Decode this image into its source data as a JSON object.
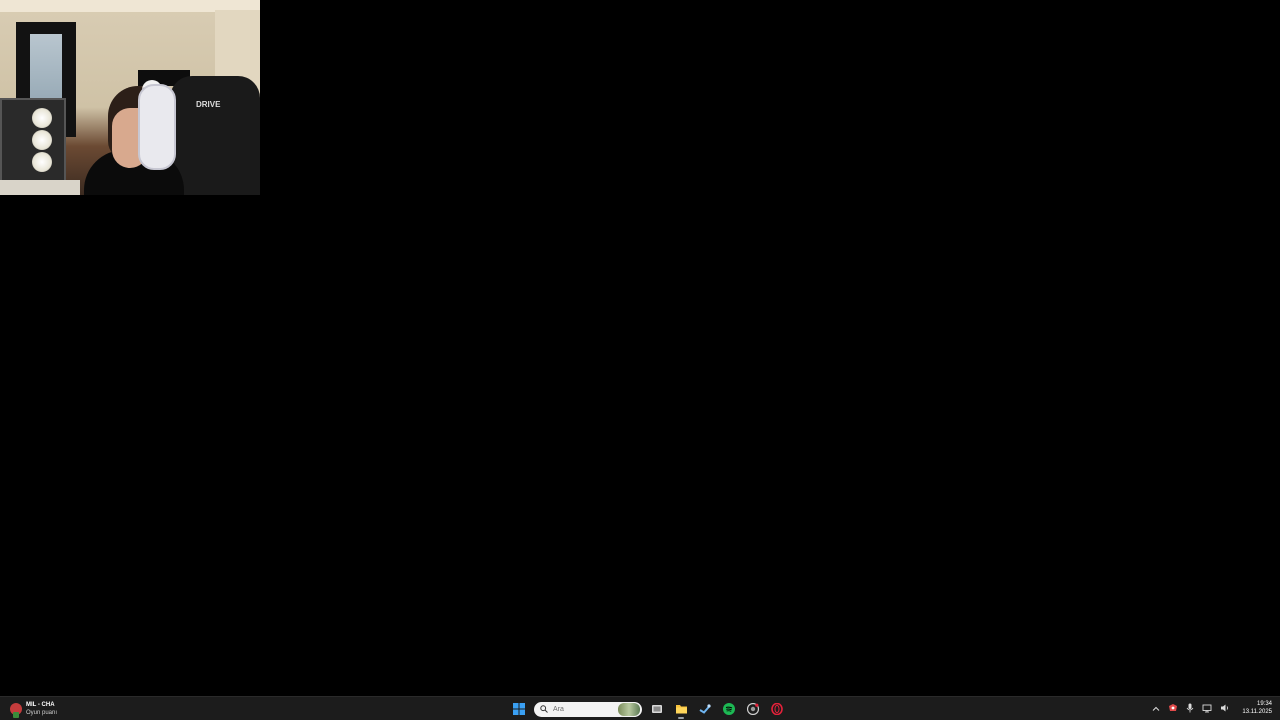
{
  "webcam": {
    "chair_brand": "DRIVE"
  },
  "taskbar": {
    "widget": {
      "title": "MIL - CHA",
      "subtitle": "Oyun puanı"
    },
    "search": {
      "placeholder": "Ara"
    },
    "apps": [
      {
        "icon": "windows-start-icon"
      },
      {
        "icon": "search-icon"
      },
      {
        "icon": "task-view-icon"
      },
      {
        "icon": "file-explorer-icon"
      },
      {
        "icon": "steam-icon"
      },
      {
        "icon": "spotify-icon"
      },
      {
        "icon": "chrome-icon"
      },
      {
        "icon": "opera-gx-icon"
      }
    ],
    "tray": {
      "icons": [
        "chevron-up-icon",
        "antivirus-icon",
        "microphone-icon",
        "network-icon",
        "volume-icon"
      ]
    },
    "clock": {
      "time": "19:34",
      "date": "13.11.2025"
    }
  },
  "colors": {
    "desktop_background": "#000000",
    "taskbar_background": "#1c1c1c",
    "spotify_green": "#1db954",
    "opera_red": "#e3213a",
    "windows_blue": "#3aa0f3"
  }
}
